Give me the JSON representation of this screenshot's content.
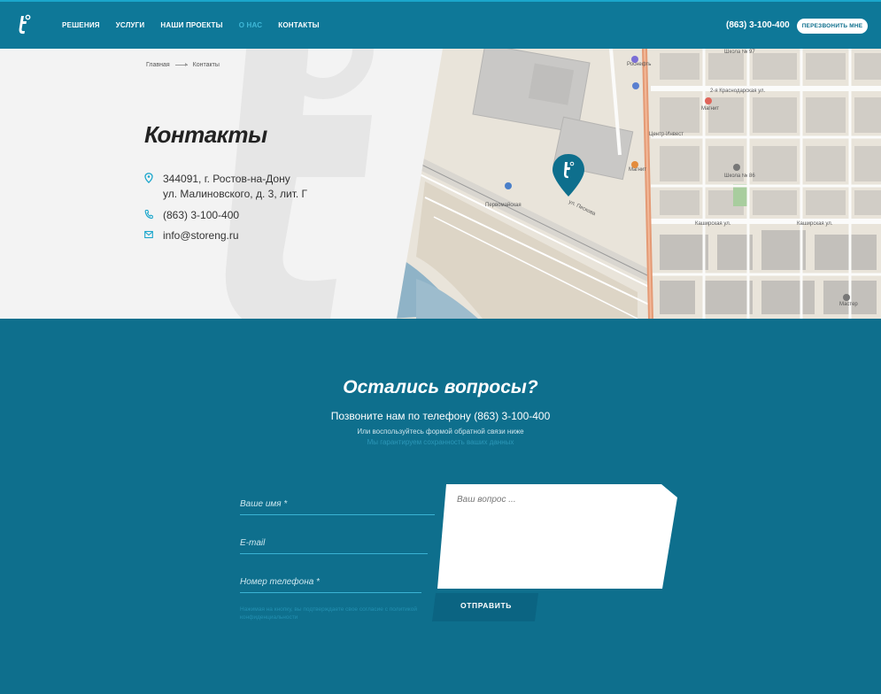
{
  "header": {
    "nav": [
      {
        "label": "РЕШЕНИЯ",
        "active": false
      },
      {
        "label": "УСЛУГИ",
        "active": false
      },
      {
        "label": "НАШИ ПРОЕКТЫ",
        "active": false
      },
      {
        "label": "О НАС",
        "active": true
      },
      {
        "label": "КОНТАКТЫ",
        "active": false
      }
    ],
    "phone": "(863) 3-100-400",
    "callback_label": "ПЕРЕЗВОНИТЬ МНЕ"
  },
  "breadcrumb": {
    "home": "Главная",
    "current": "Контакты"
  },
  "page_title": "Контакты",
  "contacts": {
    "address_line1": "344091, г. Ростов-на-Дону",
    "address_line2": "ул. Малиновского, д. 3, лит. Г",
    "phone": "(863) 3-100-400",
    "email": "info@storeng.ru"
  },
  "map": {
    "labels": {
      "street_krasnodarskaya": "2-я Краснодарская ул.",
      "street_kashirskaya": "Каширская ул.",
      "street_kashirskaya2": "Каширская ул.",
      "street_peskova": "ул. Пескова",
      "station": "Первомайская",
      "school_97": "Школа № 97",
      "rosneft": "Роснефть",
      "magnit1": "Магнит",
      "magnit2": "Магнит",
      "school_86": "Школа № 86",
      "center_invest": "Центр-Инвест",
      "master": "Мастер"
    },
    "colors": {
      "base": "#e9e4da",
      "road": "#fbfbfa",
      "main_road": "#e49a75",
      "water": "#8fb3c7",
      "building": "#c9c8c6",
      "pin": "#0e6f8d"
    }
  },
  "questions": {
    "title": "Остались вопросы?",
    "phone_line": "Позвоните нам по телефону (863) 3-100-400",
    "hint": "Или воспользуйтесь формой обратной связи ниже",
    "privacy": "Мы гарантируем сохранность ваших данных",
    "fields": {
      "name_placeholder": "Ваше имя *",
      "email_placeholder": "E-mail",
      "phone_placeholder": "Номер телефона *",
      "question_placeholder": "Ваш вопрос ..."
    },
    "consent": "Нажимая на кнопку, вы подтверждаете свое согласие с политикой конфиденциальности",
    "submit_label": "ОТПРАВИТЬ"
  },
  "colors": {
    "header": "#0e7898",
    "section": "#0e6f8d",
    "accent": "#1aa6cc",
    "title_dark": "#222222"
  }
}
